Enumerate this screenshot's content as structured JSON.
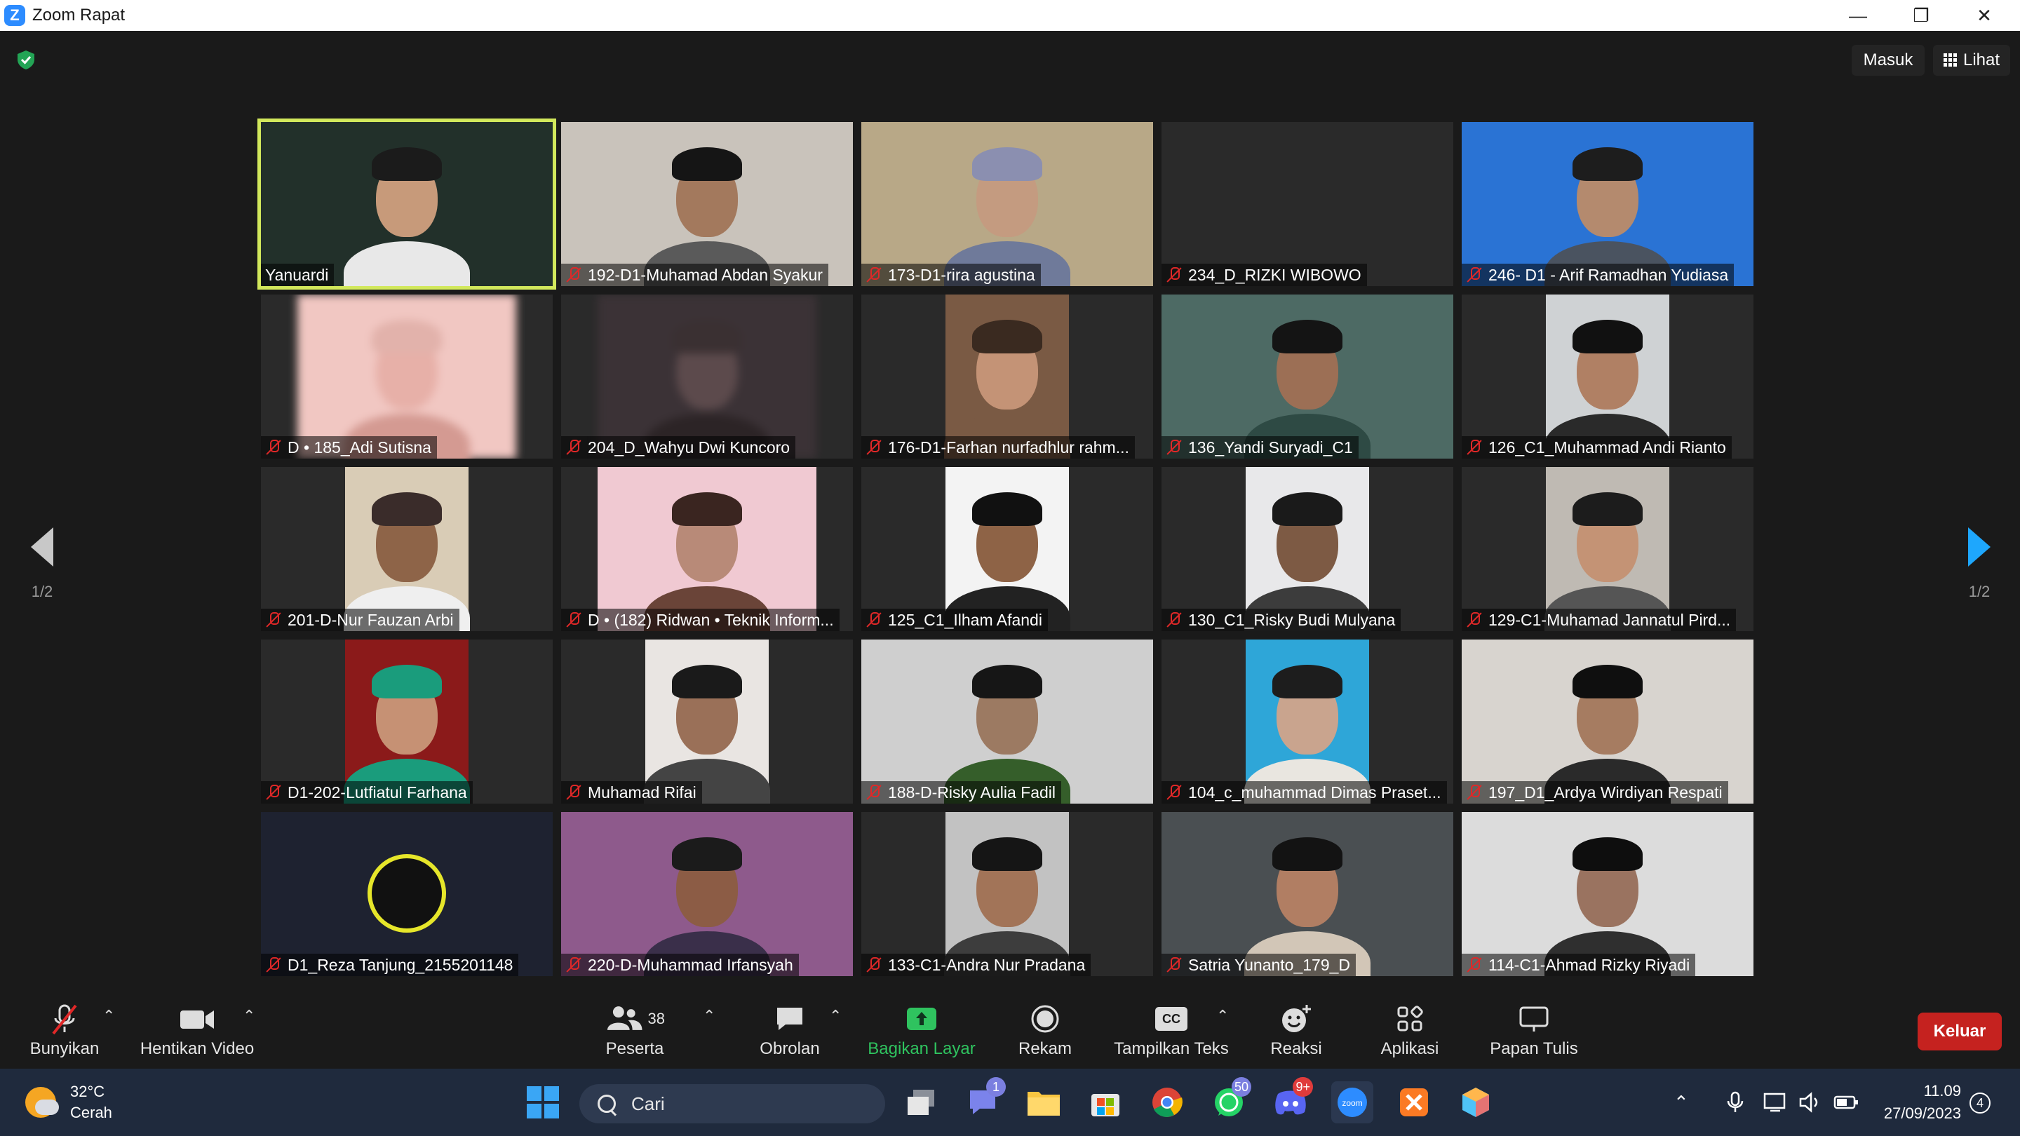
{
  "window": {
    "app_title": "Zoom Rapat",
    "logo_letter": "Z"
  },
  "top": {
    "masuk_label": "Masuk",
    "lihat_label": "Lihat"
  },
  "pagination": {
    "left": "1/2",
    "right": "1/2"
  },
  "participants": [
    {
      "name": "Yanuardi",
      "muted": false,
      "active": true
    },
    {
      "name": "192-D1-Muhamad Abdan Syakur",
      "muted": true
    },
    {
      "name": "173-D1-rira agustina",
      "muted": true
    },
    {
      "name": "234_D_RIZKI WIBOWO",
      "muted": true,
      "video_off": true
    },
    {
      "name": "246- D1 - Arif Ramadhan Yudiasa",
      "muted": true
    },
    {
      "name": "D • 185_Adi Sutisna",
      "muted": true
    },
    {
      "name": "204_D_Wahyu Dwi Kuncoro",
      "muted": true
    },
    {
      "name": "176-D1-Farhan nurfadhlur rahm...",
      "muted": true
    },
    {
      "name": "136_Yandi Suryadi_C1",
      "muted": true
    },
    {
      "name": "126_C1_Muhammad Andi Rianto",
      "muted": true
    },
    {
      "name": "201-D-Nur Fauzan Arbi",
      "muted": true
    },
    {
      "name": "D • (182) Ridwan • Teknik Inform...",
      "muted": true
    },
    {
      "name": "125_C1_Ilham Afandi",
      "muted": true
    },
    {
      "name": "130_C1_Risky Budi Mulyana",
      "muted": true
    },
    {
      "name": "129-C1-Muhamad Jannatul Pird...",
      "muted": true
    },
    {
      "name": "D1-202-Lutfiatul Farhana",
      "muted": true
    },
    {
      "name": "Muhamad Rifai",
      "muted": true
    },
    {
      "name": "188-D-Risky Aulia Fadil",
      "muted": true
    },
    {
      "name": "104_c_muhammad Dimas Praset...",
      "muted": true
    },
    {
      "name": "197_D1_Ardya Wirdiyan Respati",
      "muted": true
    },
    {
      "name": "D1_Reza Tanjung_2155201148",
      "muted": true
    },
    {
      "name": "220-D-Muhammad Irfansyah",
      "muted": true
    },
    {
      "name": "133-C1-Andra Nur Pradana",
      "muted": true
    },
    {
      "name": "Satria Yunanto_179_D",
      "muted": true
    },
    {
      "name": "114-C1-Ahmad Rizky Riyadi",
      "muted": true
    }
  ],
  "toolbar": {
    "unmute_label": "Bunyikan",
    "stop_video_label": "Hentikan Video",
    "participants_label": "Peserta",
    "participants_count": "38",
    "chat_label": "Obrolan",
    "share_label": "Bagikan Layar",
    "record_label": "Rekam",
    "captions_label": "Tampilkan Teks",
    "captions_icon_text": "CC",
    "reactions_label": "Reaksi",
    "apps_label": "Aplikasi",
    "whiteboard_label": "Papan Tulis",
    "leave_label": "Keluar",
    "share_color": "#2fc35f",
    "leave_color": "#c5221f"
  },
  "taskbar": {
    "weather_temp": "32°C",
    "weather_desc": "Cerah",
    "search_placeholder": "Cari",
    "teams_badge": "1",
    "whatsapp_badge": "50",
    "discord_badge": "9+",
    "time": "11.09",
    "date": "27/09/2023",
    "notifications": "4"
  }
}
